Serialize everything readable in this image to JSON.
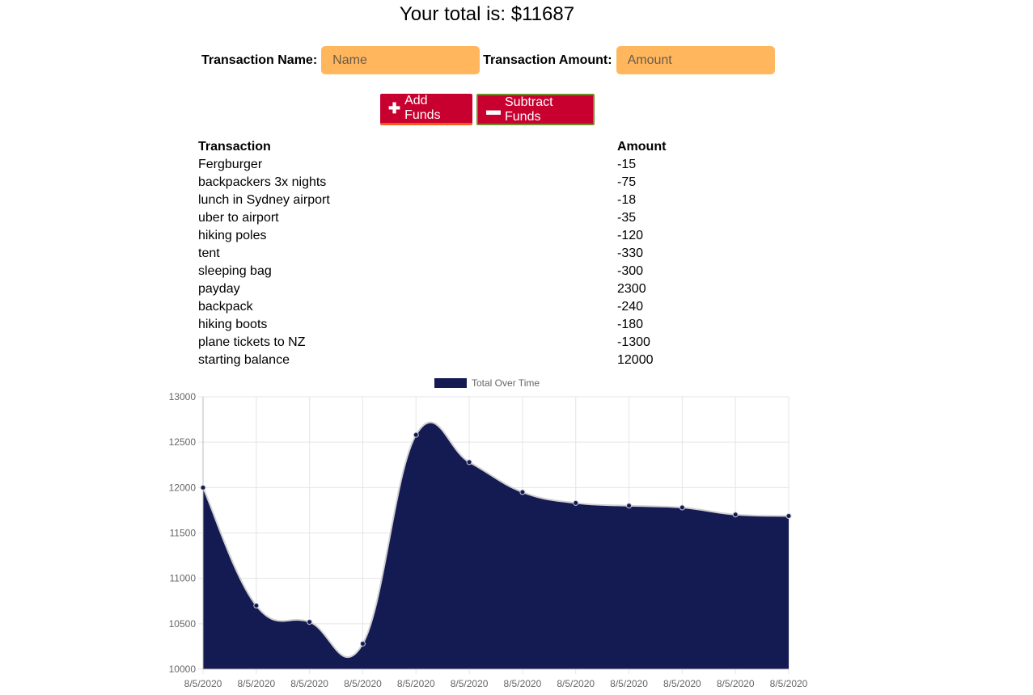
{
  "header": {
    "total_text": "Your total is: $11687"
  },
  "form": {
    "name_label": "Transaction Name:",
    "name_placeholder": "Name",
    "amount_label": "Transaction Amount:",
    "amount_placeholder": "Amount",
    "input_color": "#ffb65d"
  },
  "buttons": {
    "add_label": "Add Funds",
    "add_icon": "plus-icon",
    "subtract_label": "Subtract Funds",
    "subtract_icon": "minus-icon",
    "color": "#c8002f"
  },
  "table": {
    "headers": [
      "Transaction",
      "Amount"
    ],
    "rows": [
      {
        "name": "Fergburger",
        "amount": "-15"
      },
      {
        "name": "backpackers 3x nights",
        "amount": "-75"
      },
      {
        "name": "lunch in Sydney airport",
        "amount": "-18"
      },
      {
        "name": "uber to airport",
        "amount": "-35"
      },
      {
        "name": "hiking poles",
        "amount": "-120"
      },
      {
        "name": "tent",
        "amount": "-330"
      },
      {
        "name": "sleeping bag",
        "amount": "-300"
      },
      {
        "name": "payday",
        "amount": "2300"
      },
      {
        "name": "backpack",
        "amount": "-240"
      },
      {
        "name": "hiking boots",
        "amount": "-180"
      },
      {
        "name": "plane tickets to NZ",
        "amount": "-1300"
      },
      {
        "name": "starting balance",
        "amount": "12000"
      }
    ]
  },
  "chart_data": {
    "type": "area",
    "legend": "Total Over Time",
    "legend_position": "top",
    "color": "#141a52",
    "x": [
      "8/5/2020",
      "8/5/2020",
      "8/5/2020",
      "8/5/2020",
      "8/5/2020",
      "8/5/2020",
      "8/5/2020",
      "8/5/2020",
      "8/5/2020",
      "8/5/2020",
      "8/5/2020",
      "8/5/2020"
    ],
    "series": [
      {
        "name": "Total Over Time",
        "values": [
          12000,
          10700,
          10520,
          10280,
          12580,
          12280,
          11950,
          11830,
          11800,
          11780,
          11702,
          11687
        ]
      }
    ],
    "ylim": [
      10000,
      13000
    ],
    "yticks": [
      10000,
      10500,
      11000,
      11500,
      12000,
      12500,
      13000
    ],
    "grid": true
  }
}
